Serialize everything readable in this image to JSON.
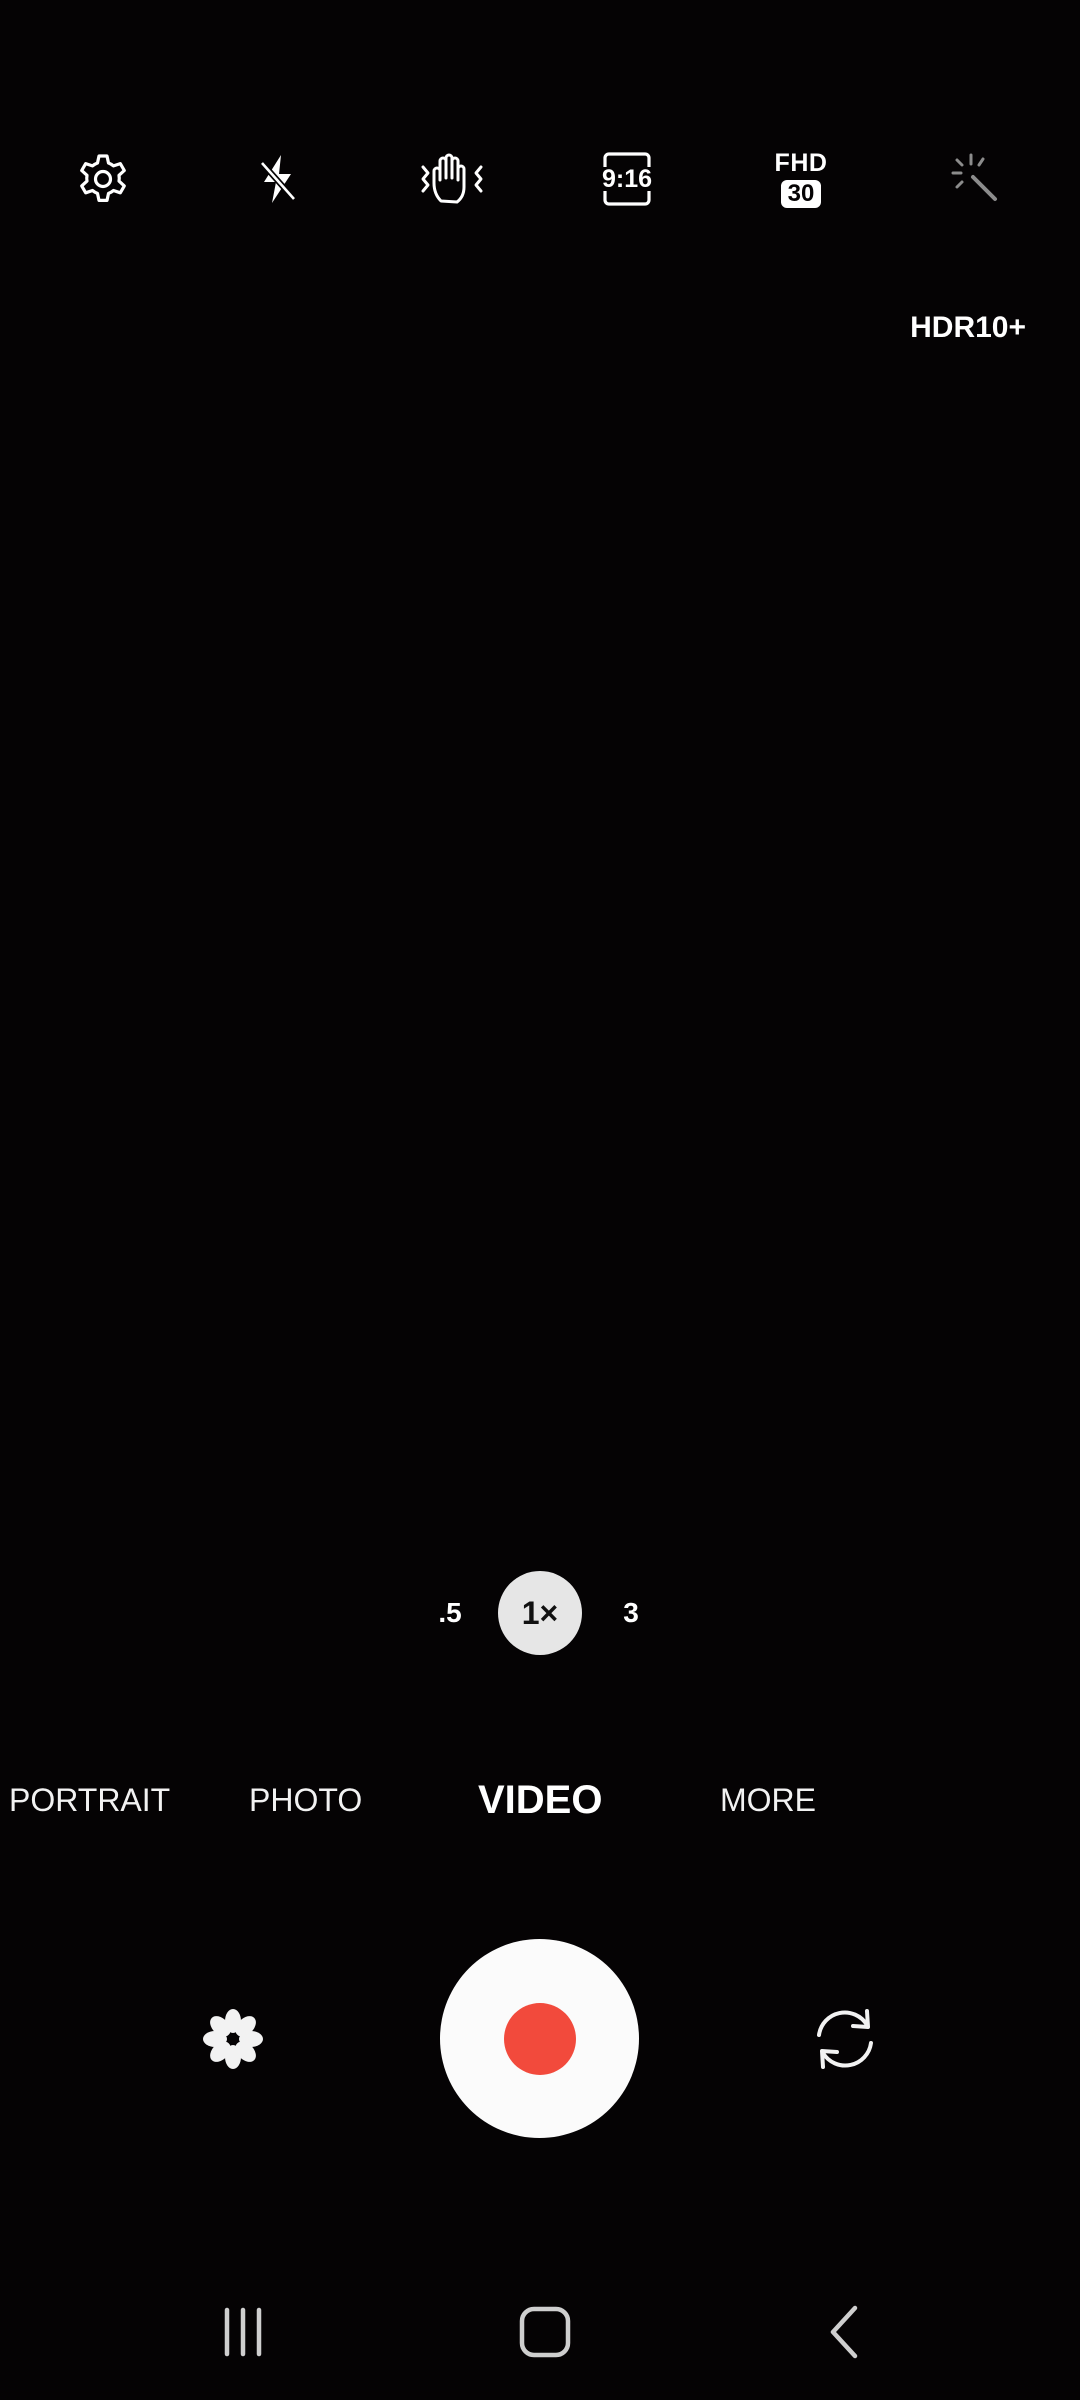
{
  "top_bar": {
    "settings_icon": "gear-icon",
    "flash_icon": "flash-off-icon",
    "stabilization_icon": "hand-shake-icon",
    "aspect_ratio_label": "9:16",
    "resolution_label": "FHD",
    "fps_label": "30",
    "effects_icon": "magic-wand-icon"
  },
  "hdr_badge": "HDR10+",
  "zoom": {
    "options": [
      ".5",
      "1×",
      "3"
    ],
    "selected": "1×"
  },
  "modes": {
    "items": [
      "PORTRAIT",
      "PHOTO",
      "VIDEO",
      "MORE"
    ],
    "selected": "VIDEO"
  },
  "bottom_controls": {
    "filter_icon": "flower-icon",
    "record_icon": "record-icon",
    "switch_camera_icon": "camera-switch-icon",
    "record_color": "#f24a3c"
  },
  "nav_bar": {
    "recents_icon": "recents-icon",
    "home_icon": "home-icon",
    "back_icon": "back-icon"
  }
}
